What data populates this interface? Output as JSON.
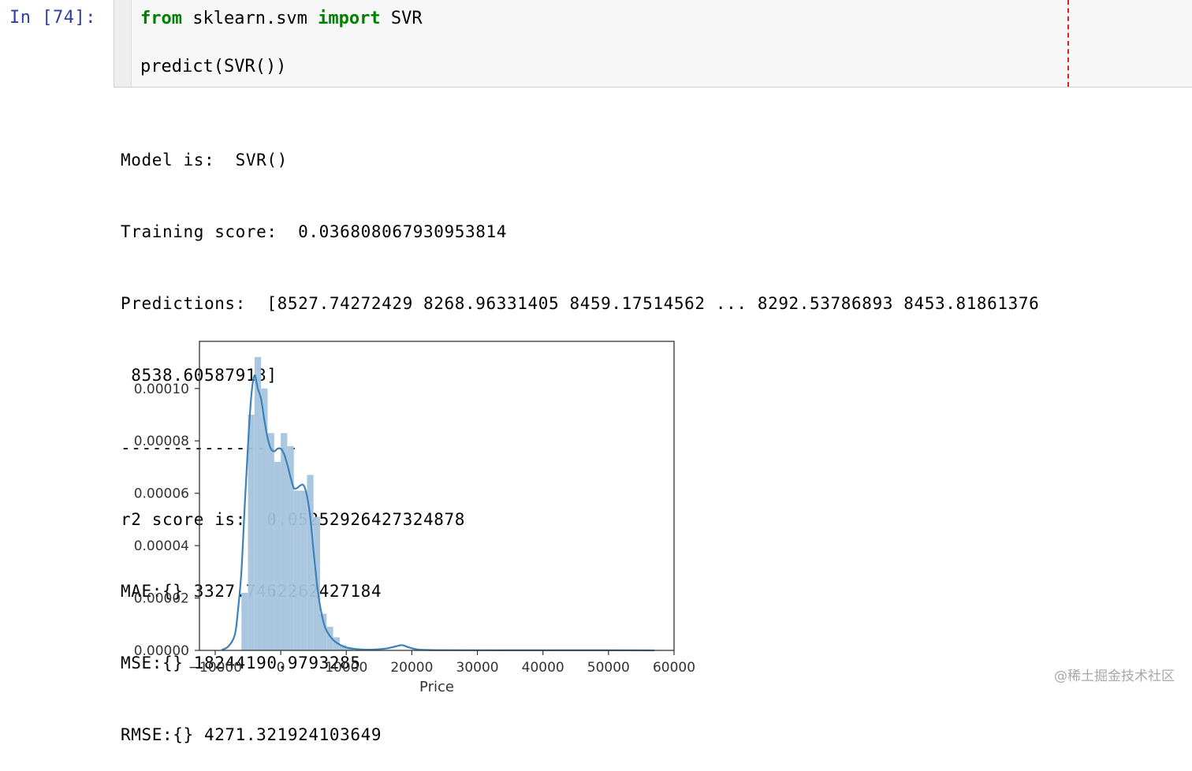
{
  "cell": {
    "prompt": "In [74]:",
    "code": {
      "line1": {
        "kw1": "from",
        "mid": " sklearn.svm ",
        "kw2": "import",
        "rest": " SVR"
      },
      "line2": "predict(SVR())"
    }
  },
  "output": {
    "lines": [
      "Model is:  SVR()",
      "Training score:  0.036808067930953814",
      "Predictions:  [8527.74272429 8268.96331405 8459.17514562 ... 8292.53786893 8453.81861376",
      " 8538.60587913]",
      "-----------------",
      "r2 score is:  0.05252926427324878",
      "MAE:{} 3327.7462262427184",
      "MSE:{} 18244190.9793285",
      "RMSE:{} 4271.321924103649"
    ]
  },
  "chart_data": {
    "type": "histogram+kde",
    "xlabel": "Price",
    "ylabel": "",
    "xlim": [
      -12400,
      60000
    ],
    "ylim": [
      0,
      0.000118
    ],
    "x_ticks": [
      -10000,
      0,
      10000,
      20000,
      30000,
      40000,
      50000,
      60000
    ],
    "x_tick_labels": [
      "−10000",
      "0",
      "10000",
      "20000",
      "30000",
      "40000",
      "50000",
      "60000"
    ],
    "y_ticks": [
      0,
      2e-05,
      4e-05,
      6e-05,
      8e-05,
      0.0001
    ],
    "y_tick_labels": [
      "0.00000",
      "0.00002",
      "0.00004",
      "0.00006",
      "0.00008",
      "0.00010"
    ],
    "bin_width": 1000,
    "bins": [
      {
        "x0": -6000,
        "density": 2.2e-05
      },
      {
        "x0": -5000,
        "density": 9e-05
      },
      {
        "x0": -4000,
        "density": 0.000112
      },
      {
        "x0": -3000,
        "density": 0.0001
      },
      {
        "x0": -2000,
        "density": 8.3e-05
      },
      {
        "x0": -1000,
        "density": 7.2e-05
      },
      {
        "x0": 0,
        "density": 8.3e-05
      },
      {
        "x0": 1000,
        "density": 7.8e-05
      },
      {
        "x0": 2000,
        "density": 6.1e-05
      },
      {
        "x0": 3000,
        "density": 6.1e-05
      },
      {
        "x0": 4000,
        "density": 6.7e-05
      },
      {
        "x0": 5000,
        "density": 5.1e-05
      },
      {
        "x0": 6000,
        "density": 1.4e-05
      },
      {
        "x0": 7000,
        "density": 9e-06
      },
      {
        "x0": 8000,
        "density": 5e-06
      },
      {
        "x0": 9000,
        "density": 2e-06
      },
      {
        "x0": 10000,
        "density": 1e-06
      }
    ],
    "kde": {
      "x": [
        -9000,
        -8000,
        -7000,
        -6500,
        -6000,
        -5500,
        -5000,
        -4500,
        -4000,
        -3500,
        -3000,
        -2500,
        -2000,
        -1500,
        -1000,
        -500,
        0,
        500,
        1000,
        1500,
        2000,
        2500,
        3000,
        3500,
        4000,
        4500,
        5000,
        5500,
        6000,
        6500,
        7000,
        8000,
        9000,
        10000,
        12000,
        14000,
        16000,
        17500,
        18500,
        19500,
        21000,
        24000,
        30000,
        40000,
        50000,
        57000
      ],
      "y": [
        2e-07,
        1.5e-06,
        6e-06,
        1.6e-05,
        3e-05,
        5.5e-05,
        7.8e-05,
        9.7e-05,
        0.000105,
        0.0001,
        9.6e-05,
        8.8e-05,
        8.1e-05,
        7.7e-05,
        7.6e-05,
        7.7e-05,
        7.7e-05,
        7.5e-05,
        7.1e-05,
        6.6e-05,
        6.2e-05,
        6.2e-05,
        6.3e-05,
        6.3e-05,
        5.9e-05,
        5.1e-05,
        3.8e-05,
        2.6e-05,
        1.7e-05,
        1.1e-05,
        7.5e-06,
        4e-06,
        2.2e-06,
        1.1e-06,
        4e-07,
        3e-07,
        7e-07,
        1.5e-06,
        2e-06,
        1.2e-06,
        3e-07,
        1e-07,
        5e-08,
        3e-08,
        3e-08,
        1e-08
      ]
    }
  },
  "colors": {
    "prompt": "#303f9f",
    "keyword": "#008000",
    "hist_fill": "#a6c4de",
    "kde_line": "#3b82b8",
    "ruler": "#d9201c"
  },
  "watermark": "@稀土掘金技术社区"
}
